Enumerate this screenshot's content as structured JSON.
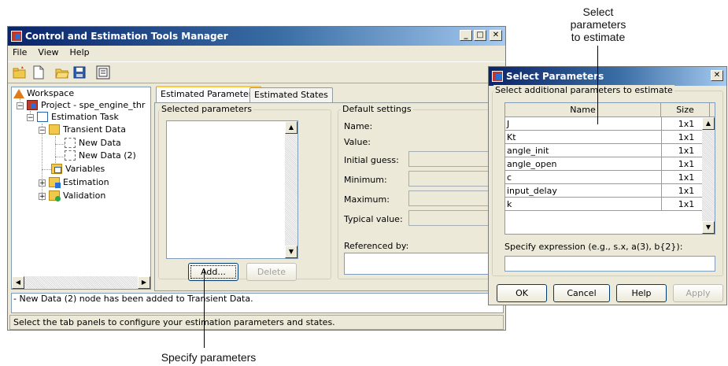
{
  "main_window": {
    "title": "Control and Estimation Tools Manager",
    "menu": [
      "File",
      "View",
      "Help"
    ],
    "title_buttons": [
      "_",
      "□",
      "✕"
    ],
    "tree": {
      "workspace": "Workspace",
      "project": "Project - spe_engine_thr",
      "task": "Estimation Task",
      "transient": "Transient Data",
      "new_data": "New Data",
      "new_data_2": "New Data (2)",
      "variables": "Variables",
      "estimation": "Estimation",
      "validation": "Validation"
    },
    "tabs": [
      "Estimated Parameters",
      "Estimated States"
    ],
    "selected_parameters_label": "Selected parameters",
    "add_button": "Add...",
    "delete_button": "Delete",
    "default_settings_label": "Default settings",
    "name_label": "Name:",
    "value_label": "Value:",
    "initial_guess_label": "Initial guess:",
    "minimum_label": "Minimum:",
    "maximum_label": "Maximum:",
    "typical_value_label": "Typical value:",
    "referenced_by_label": "Referenced by:",
    "message": "- New Data (2) node has been added to Transient Data.",
    "status": "Select the tab panels to configure your estimation parameters and states."
  },
  "dialog": {
    "title": "Select Parameters",
    "close": "✕",
    "group_label": "Select additional parameters to estimate",
    "columns": [
      "Name",
      "Size"
    ],
    "rows": [
      {
        "name": "J",
        "size": "1x1"
      },
      {
        "name": "Kt",
        "size": "1x1"
      },
      {
        "name": "angle_init",
        "size": "1x1"
      },
      {
        "name": "angle_open",
        "size": "1x1"
      },
      {
        "name": "c",
        "size": "1x1"
      },
      {
        "name": "input_delay",
        "size": "1x1"
      },
      {
        "name": "k",
        "size": "1x1"
      }
    ],
    "expression_label": "Specify expression (e.g., s.x, a(3), b{2}):",
    "ok": "OK",
    "cancel": "Cancel",
    "help": "Help",
    "apply": "Apply"
  },
  "callouts": {
    "select_line1": "Select",
    "select_line2": "parameters",
    "select_line3": "to estimate",
    "specify": "Specify parameters"
  }
}
